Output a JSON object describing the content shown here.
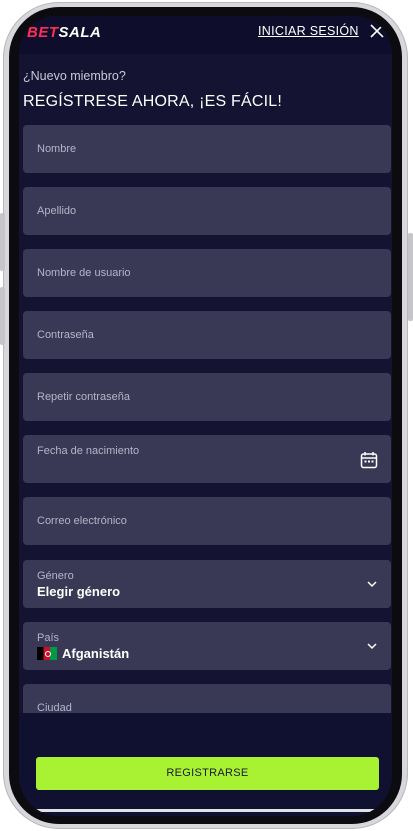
{
  "header": {
    "logo_part1": "BET",
    "logo_part2": "SALA",
    "login_label": "INICIAR SESIÓN",
    "close_icon": "close-icon"
  },
  "intro": {
    "question": "¿Nuevo miembro?",
    "title": "REGÍSTRESE AHORA, ¡ES FÁCIL!"
  },
  "form": {
    "first_name_placeholder": "Nombre",
    "last_name_placeholder": "Apellido",
    "username_placeholder": "Nombre de usuario",
    "password_placeholder": "Contraseña",
    "repeat_password_placeholder": "Repetir contraseña",
    "birthdate_placeholder": "Fecha de nacimiento",
    "email_placeholder": "Correo electrónico",
    "gender_label": "Género",
    "gender_value": "Elegir género",
    "country_label": "País",
    "country_value": "Afganistán",
    "city_placeholder": "Ciudad"
  },
  "actions": {
    "register_label": "REGISTRARSE"
  },
  "colors": {
    "brand_red": "#ff2d55",
    "accent_green": "#a8f233",
    "background": "#141432",
    "field_bg": "#393956"
  }
}
